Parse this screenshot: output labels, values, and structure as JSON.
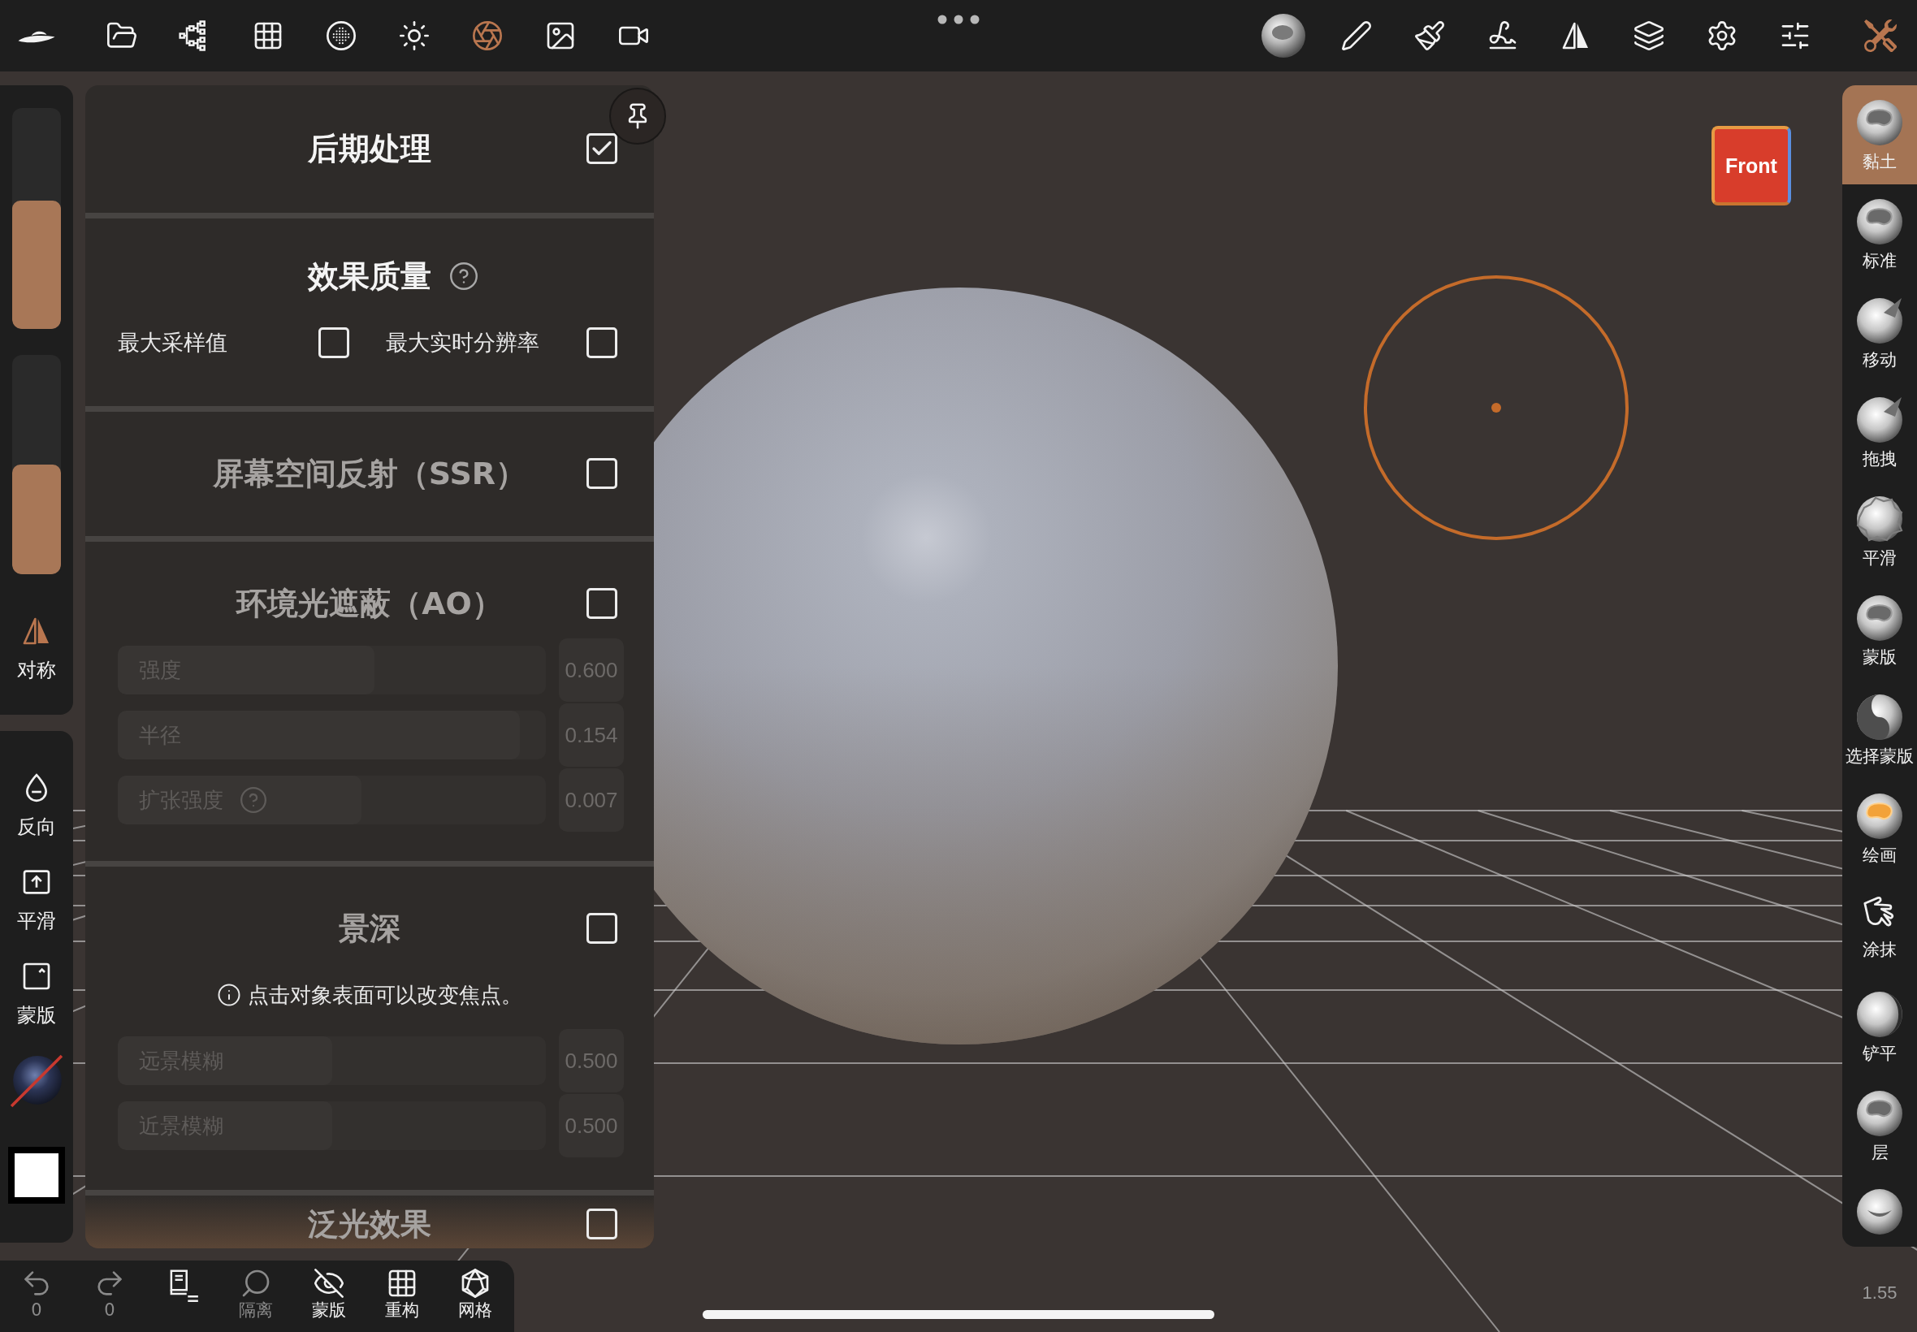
{
  "top_bar": {
    "left_tools": [
      {
        "selected": false
      },
      {
        "selected": false
      },
      {
        "selected": false
      },
      {
        "selected": false
      },
      {
        "selected": false
      },
      {
        "selected": true
      },
      {
        "selected": false
      },
      {
        "selected": false
      }
    ],
    "right_tools": [
      {
        "selected": false
      },
      {
        "selected": false
      },
      {
        "selected": false
      },
      {
        "selected": false
      },
      {
        "selected": false
      },
      {
        "selected": false
      },
      {
        "selected": false
      },
      {
        "selected": false
      },
      {
        "selected": true
      }
    ]
  },
  "left_sidebar": {
    "sliders": [
      {
        "level": 0.58
      },
      {
        "level": 0.5
      }
    ],
    "symmetry": {
      "label": "对称",
      "on": true
    },
    "actions": [
      {
        "label": "反向"
      },
      {
        "label": "平滑"
      },
      {
        "label": "蒙版"
      }
    ]
  },
  "panel": {
    "sections": [
      {
        "title": "后期处理",
        "checked": true
      },
      {
        "title": "效果质量",
        "help": true,
        "options": [
          {
            "label": "最大采样值",
            "checked": false
          },
          {
            "label": "最大实时分辨率",
            "checked": false
          }
        ]
      },
      {
        "title": "屏幕空间反射（SSR）",
        "checked": false
      },
      {
        "title": "环境光遮蔽（AO）",
        "checked": false,
        "sliders": [
          {
            "label": "强度",
            "value": "0.600",
            "level": 0.6
          },
          {
            "label": "半径",
            "value": "0.154",
            "level": 0.94
          },
          {
            "label": "扩张强度",
            "help": true,
            "value": "0.007",
            "level": 0.57
          }
        ]
      },
      {
        "title": "景深",
        "checked": false,
        "note": "点击对象表面可以改变焦点。",
        "sliders": [
          {
            "label": "远景模糊",
            "value": "0.500",
            "level": 0.5
          },
          {
            "label": "近景模糊",
            "value": "0.500",
            "level": 0.5
          }
        ]
      },
      {
        "title": "泛光效果",
        "checked": false
      }
    ]
  },
  "bottom_bar": {
    "items": [
      {
        "label": "0",
        "disabled": true
      },
      {
        "label": "0",
        "disabled": true
      },
      {
        "disabled": false
      },
      {
        "label": "隔离",
        "disabled": true
      },
      {
        "label": "蒙版",
        "disabled": false
      },
      {
        "label": "重构",
        "disabled": false
      },
      {
        "label": "网格",
        "disabled": false
      }
    ]
  },
  "right_toolbar": {
    "brushes": [
      {
        "label": "黏土",
        "selected": true
      },
      {
        "label": "标准",
        "selected": false
      },
      {
        "label": "移动",
        "selected": false
      },
      {
        "label": "拖拽",
        "selected": false
      },
      {
        "label": "平滑",
        "selected": false
      },
      {
        "label": "蒙版",
        "selected": false
      },
      {
        "label": "选择蒙版",
        "selected": false
      },
      {
        "label": "绘画",
        "selected": false
      },
      {
        "label": "涂抹",
        "selected": false
      },
      {
        "label": "铲平",
        "selected": false
      },
      {
        "label": "层",
        "selected": false
      },
      {
        "selected": false
      }
    ],
    "reading": "1.55"
  },
  "viewport": {
    "view_cube": {
      "label": "Front"
    }
  }
}
